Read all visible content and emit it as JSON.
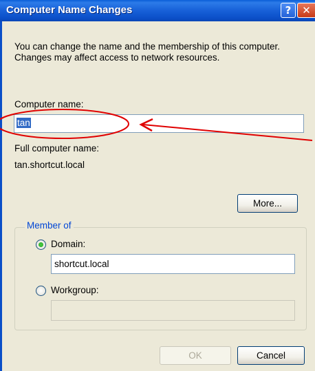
{
  "window": {
    "title": "Computer Name Changes",
    "help_glyph": "?",
    "close_glyph": "✕"
  },
  "description": "You can change the name and the membership of this computer. Changes may affect access to network resources.",
  "computer_name": {
    "label": "Computer name:",
    "value": "tan"
  },
  "full_name": {
    "label": "Full computer name:",
    "value": "tan.shortcut.local"
  },
  "more_button": "More...",
  "member_of": {
    "legend": "Member of",
    "domain_label": "Domain:",
    "domain_value": "shortcut.local",
    "domain_selected": true,
    "workgroup_label": "Workgroup:",
    "workgroup_value": "",
    "workgroup_selected": false
  },
  "buttons": {
    "ok": "OK",
    "cancel": "Cancel"
  },
  "colors": {
    "annotation": "#e00000",
    "selection": "#316ac5",
    "titlebar": "#0a5ed8"
  }
}
